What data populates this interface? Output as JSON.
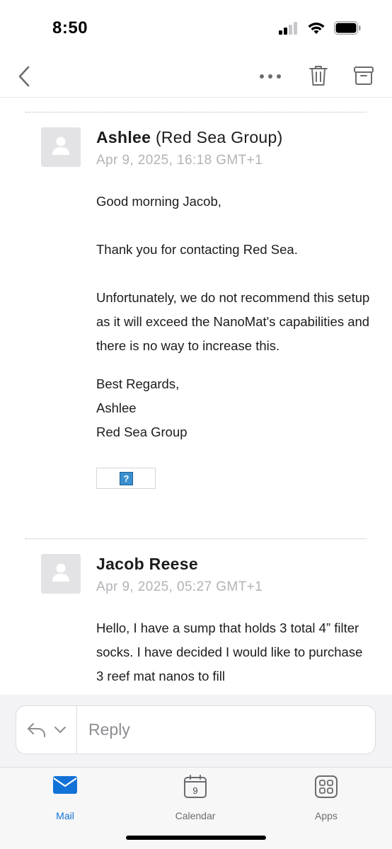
{
  "status_bar": {
    "time": "8:50"
  },
  "toolbar": {
    "icons": [
      "back-chevron-icon",
      "more-icon",
      "trash-icon",
      "archive-icon"
    ]
  },
  "messages": [
    {
      "sender_name": "Ashlee",
      "sender_org": "(Red Sea Group)",
      "date": "Apr 9, 2025, 16:18 GMT+1",
      "body": [
        "Good morning Jacob,",
        "Thank you for contacting Red Sea.",
        "Unfortunately, we do not recommend this setup as it will exceed the NanoMat's capabilities and there is no way to increase this."
      ],
      "signature": [
        "Best Regards,",
        "Ashlee",
        "Red Sea Group"
      ],
      "signature_image": "?"
    },
    {
      "sender_name": "Jacob Reese",
      "date": "Apr 9, 2025, 05:27 GMT+1",
      "body": [
        "Hello, I have a sump that holds 3 total 4” filter socks. I have decided I would like to purchase 3 reef mat nanos to fill"
      ]
    }
  ],
  "reply": {
    "placeholder": "Reply"
  },
  "tab_bar": {
    "tabs": [
      {
        "label": "Mail",
        "icon": "mail-icon",
        "active": true
      },
      {
        "label": "Calendar",
        "icon": "calendar-icon",
        "calendar_day": "9",
        "active": false
      },
      {
        "label": "Apps",
        "icon": "apps-icon",
        "active": false
      }
    ]
  },
  "colors": {
    "accent": "#1372d8",
    "secondary_text": "#b3b3b8",
    "avatar_bg": "#e3e3e6"
  }
}
